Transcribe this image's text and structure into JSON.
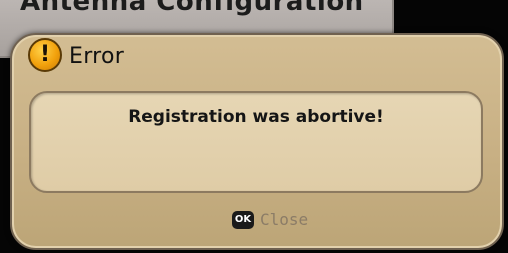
{
  "background_window": {
    "title": "Antenna Configuration"
  },
  "dialog": {
    "icon": "warning-exclamation-icon",
    "icon_glyph": "!",
    "title": "Error",
    "message": "Registration was abortive!",
    "close_key": "OK",
    "close_label": "Close"
  },
  "colors": {
    "dialog_bg": "#c8b084",
    "message_bg": "#e1cfaa",
    "icon_orange": "#f2a10c",
    "close_text": "#8b7c67"
  }
}
